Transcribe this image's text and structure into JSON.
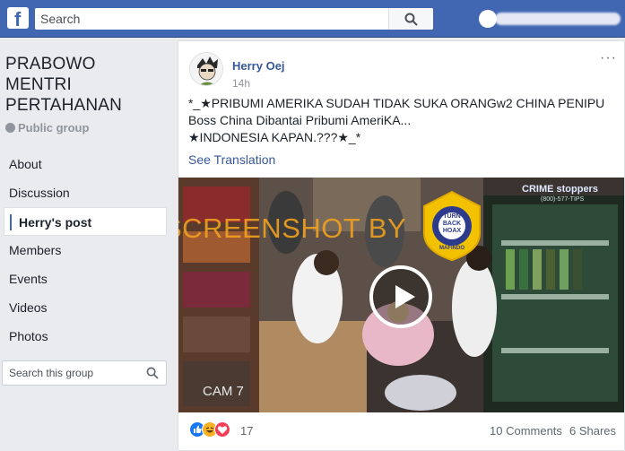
{
  "topbar": {
    "logo_letter": "f",
    "search_placeholder": "Search",
    "search_icon": "search-icon",
    "brand_color": "#4267b2"
  },
  "group": {
    "title_lines": [
      "PRABOWO",
      "MENTRI",
      "PERTAHANAN"
    ],
    "type": "Public group",
    "nav": [
      {
        "label": "About"
      },
      {
        "label": "Discussion"
      },
      {
        "label": "Herry's post",
        "active": true
      },
      {
        "label": "Members"
      },
      {
        "label": "Events"
      },
      {
        "label": "Videos"
      },
      {
        "label": "Photos"
      }
    ],
    "search_placeholder": "Search this group"
  },
  "post": {
    "author": "Herry Oej",
    "time": "14h",
    "menu": "···",
    "text_lines": [
      "*_★PRIBUMI AMERIKA SUDAH TIDAK SUKA ORANGw2 CHINA PENIPU",
      "Boss China Dibantai Pribumi AmeriKA...",
      "★INDONESIA KAPAN.???★_*"
    ],
    "see_translation": "See Translation",
    "video": {
      "watermark": "SCREENSHOT BY",
      "cam_label": "CAM 7",
      "corner_brand": "CRIME stoppers",
      "corner_phone": "(800)-577-TIPS",
      "badge_lines": [
        "TURN",
        "BACK",
        "HOAX"
      ],
      "badge_ring_text": "MASYARAKAT ANTI FITNAH INDONESIA",
      "badge_org": "MAFINDO"
    },
    "reactions": {
      "types": [
        "like",
        "haha",
        "love"
      ],
      "count": "17"
    },
    "comments": "10 Comments",
    "shares": "6 Shares"
  }
}
